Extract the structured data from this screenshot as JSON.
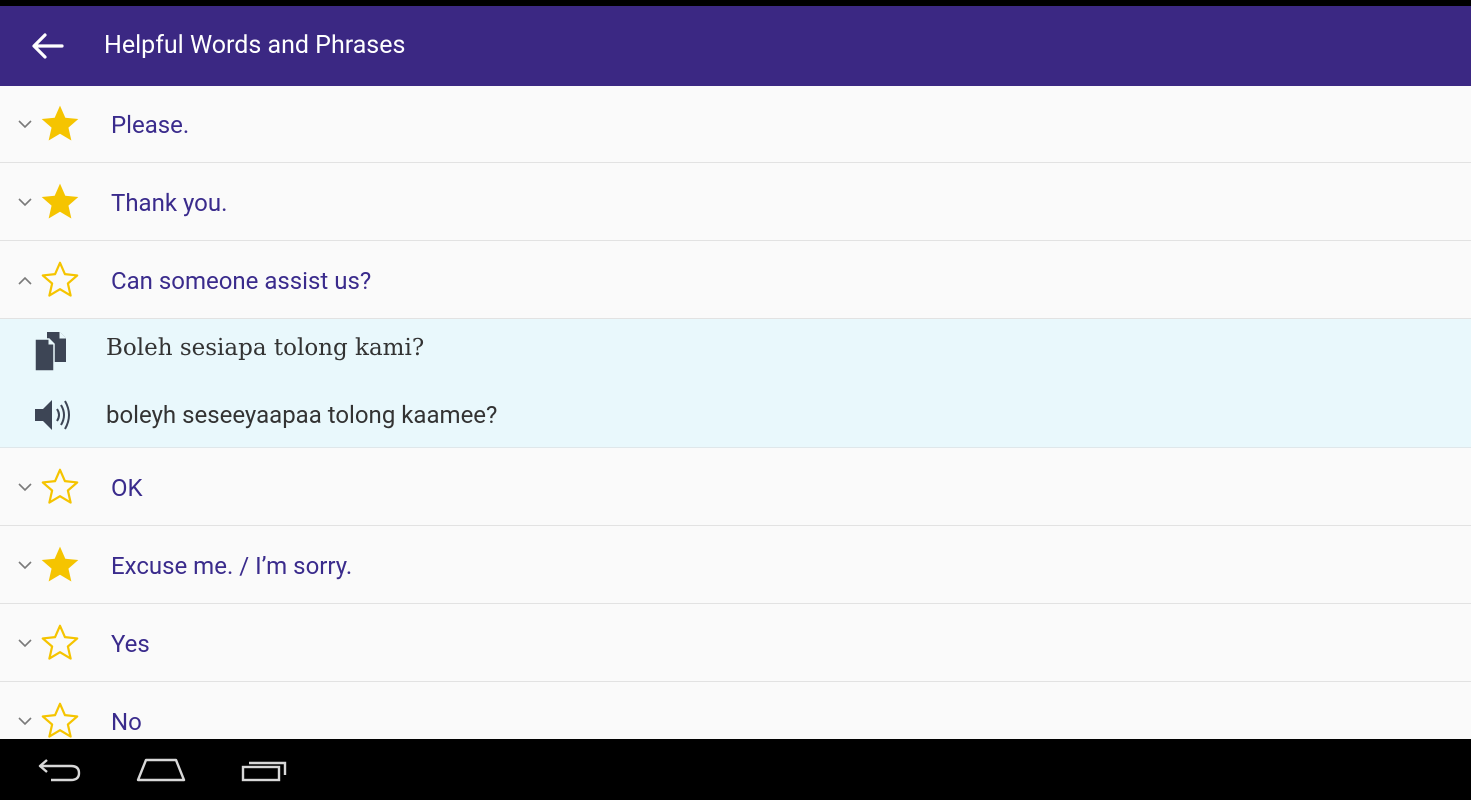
{
  "appbar": {
    "title": "Helpful Words and Phrases",
    "back_icon": "arrow-back-icon",
    "color": "#3b2883"
  },
  "phrases": [
    {
      "label": "Please.",
      "favorite": true,
      "expanded": false
    },
    {
      "label": "Thank you.",
      "favorite": true,
      "expanded": false
    },
    {
      "label": "Can someone assist us?",
      "favorite": false,
      "expanded": true
    },
    {
      "label": "OK",
      "favorite": false,
      "expanded": false
    },
    {
      "label": "Excuse me. / I’m sorry.",
      "favorite": true,
      "expanded": false
    },
    {
      "label": "Yes",
      "favorite": false,
      "expanded": false
    },
    {
      "label": "No",
      "favorite": false,
      "expanded": false
    }
  ],
  "expanded_detail": {
    "translation": "Boleh sesiapa tolong kami?",
    "pronunciation": "boleyh seseeyaapaa tolong kaamee?",
    "copy_icon": "copy-icon",
    "speaker_icon": "speaker-icon",
    "background": "#e9f8fc"
  },
  "colors": {
    "phrase_text": "#3a2b8c",
    "star": "#f5c400"
  },
  "navbar": {
    "icons": [
      "nav-back-icon",
      "nav-home-icon",
      "nav-recent-apps-icon"
    ]
  }
}
